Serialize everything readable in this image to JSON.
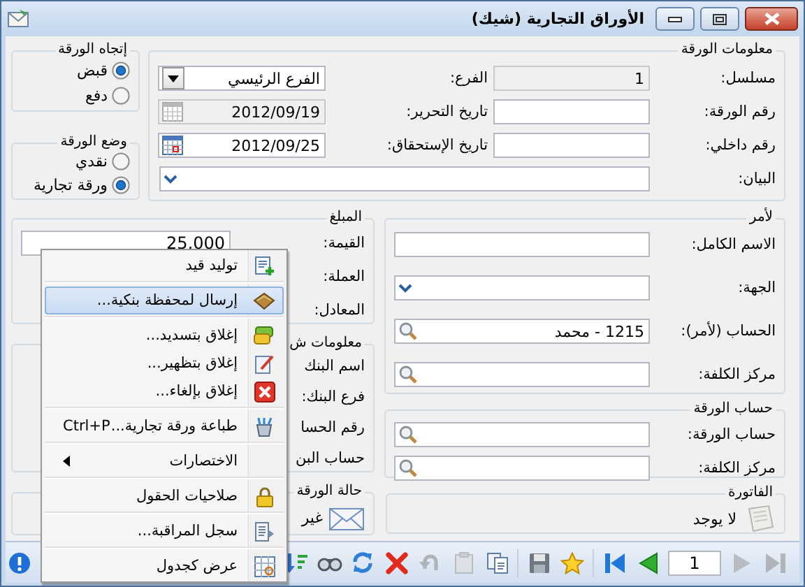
{
  "window": {
    "title": "الأوراق التجارية (شيك)"
  },
  "direction_group": {
    "title": "إتجاه الورقة",
    "options": [
      {
        "label": "قبض",
        "selected": true
      },
      {
        "label": "دفع",
        "selected": false
      }
    ]
  },
  "mode_group": {
    "title": "وضع الورقة",
    "options": [
      {
        "label": "نقدي",
        "selected": false
      },
      {
        "label": "ورقة تجارية",
        "selected": true
      }
    ]
  },
  "paper_info": {
    "title": "معلومات الورقة",
    "fields": [
      {
        "label": "مسلسل:",
        "value": "1",
        "kind": "text",
        "disabled": true
      },
      {
        "label": "الفرع:",
        "value": "الفرع الرئيسي",
        "kind": "dropdown",
        "disabled": false
      },
      {
        "label": "رقم الورقة:",
        "kind": "text",
        "disabled": false
      },
      {
        "label": "تاريخ التحرير:",
        "value": "2012/09/19",
        "kind": "date",
        "disabled": true
      },
      {
        "label": "رقم داخلي:",
        "kind": "text",
        "disabled": false
      },
      {
        "label": "تاريخ الإستحقاق:",
        "value": "2012/09/25",
        "kind": "date",
        "disabled": false
      },
      {
        "label": "البيان:",
        "kind": "combo",
        "disabled": false
      }
    ]
  },
  "payee": {
    "title": "لأمر",
    "fields": [
      {
        "label": "الاسم الكامل:",
        "kind": "text",
        "disabled": false
      },
      {
        "label": "الجهة:",
        "kind": "combo",
        "disabled": false
      },
      {
        "label": "الحساب (لأمر):",
        "value": "1215 - محمد",
        "kind": "search",
        "disabled": false
      },
      {
        "label": "مركز الكلفة:",
        "kind": "search",
        "disabled": false
      }
    ]
  },
  "paper_account": {
    "title": "حساب الورقة",
    "fields": [
      {
        "label": "حساب الورقة:",
        "kind": "search",
        "disabled": false
      },
      {
        "label": "مركز الكلفة:",
        "kind": "search",
        "disabled": false
      }
    ]
  },
  "invoice": {
    "title": "الفاتورة",
    "text": "لا يوجد"
  },
  "amount": {
    "title": "المبلغ",
    "value_field": {
      "label": "القيمة:",
      "value": "25,000"
    },
    "labels": [
      "العملة:",
      "المعادل:"
    ]
  },
  "bank_info": {
    "title": "معلومات ش",
    "labels": [
      "اسم البنك",
      "فرع البنك:",
      "رقم الحسا",
      "حساب البن"
    ]
  },
  "paper_status": {
    "title": "حالة الورقة",
    "text": "غير"
  },
  "context_menu": {
    "groups": [
      [
        {
          "label": "توليد قيد",
          "kind": "item",
          "selected": false
        }
      ],
      [
        {
          "label": "إرسال لمحفظة بنكية...",
          "kind": "item",
          "selected": true
        }
      ],
      [
        {
          "label": "إغلاق بتسديد...",
          "kind": "item",
          "selected": false
        },
        {
          "label": "إغلاق بتظهير...",
          "kind": "item",
          "selected": false
        },
        {
          "label": "إغلاق بإلغاء...",
          "kind": "item",
          "selected": false
        }
      ],
      [
        {
          "label": "طباعة ورقة تجارية...",
          "shortcut": "Ctrl+P",
          "kind": "item",
          "selected": false
        }
      ],
      [
        {
          "label": "الاختصارات",
          "kind": "submenu",
          "selected": false
        }
      ],
      [
        {
          "label": "صلاحيات الحقول",
          "kind": "item",
          "selected": false
        }
      ],
      [
        {
          "label": "سجل المراقبة...",
          "kind": "item",
          "selected": false
        }
      ],
      [
        {
          "label": "عرض كجدول",
          "kind": "item",
          "selected": false
        }
      ]
    ]
  },
  "toolbar": {
    "buttons": [
      {
        "kind": "sort",
        "disabled": false
      },
      {
        "kind": "find",
        "disabled": false
      },
      {
        "kind": "refresh",
        "disabled": false
      },
      {
        "kind": "delete",
        "disabled": false
      },
      {
        "kind": "undo",
        "disabled": true
      },
      {
        "kind": "paste",
        "disabled": true
      },
      {
        "kind": "copy",
        "disabled": false
      },
      {
        "kind": "save",
        "disabled": false
      },
      {
        "kind": "star",
        "disabled": false
      },
      {
        "kind": "first",
        "disabled": false
      },
      {
        "kind": "prev",
        "disabled": false
      },
      {
        "kind": "page",
        "value": "1",
        "disabled": false
      },
      {
        "kind": "next",
        "disabled": true
      },
      {
        "kind": "last",
        "disabled": true
      }
    ]
  }
}
